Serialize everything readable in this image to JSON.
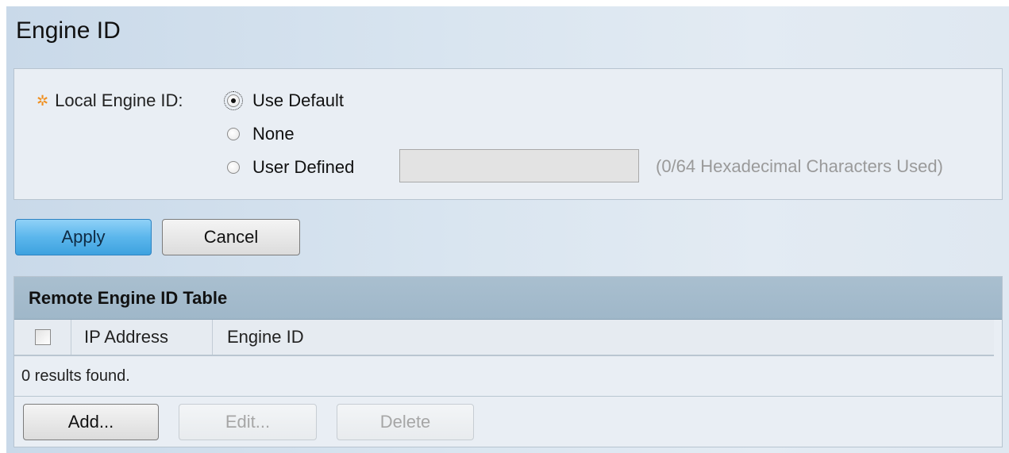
{
  "page": {
    "title": "Engine ID"
  },
  "local_engine": {
    "label": "Local Engine ID:",
    "required_icon": "required-asterisk-icon",
    "options": [
      {
        "label": "Use Default",
        "checked": true
      },
      {
        "label": "None",
        "checked": false
      },
      {
        "label": "User Defined",
        "checked": false
      }
    ],
    "user_defined_value": "",
    "hint": "(0/64 Hexadecimal Characters Used)"
  },
  "actions": {
    "apply": "Apply",
    "cancel": "Cancel"
  },
  "remote_table": {
    "title": "Remote Engine ID Table",
    "columns": [
      "IP Address",
      "Engine ID"
    ],
    "rows": [],
    "results_text": "0 results found.",
    "buttons": {
      "add": "Add...",
      "edit": "Edit...",
      "delete": "Delete"
    }
  },
  "colors": {
    "accent_button": "#5bb6ec",
    "table_header": "#a9bfcf",
    "required_icon": "#f09020"
  }
}
